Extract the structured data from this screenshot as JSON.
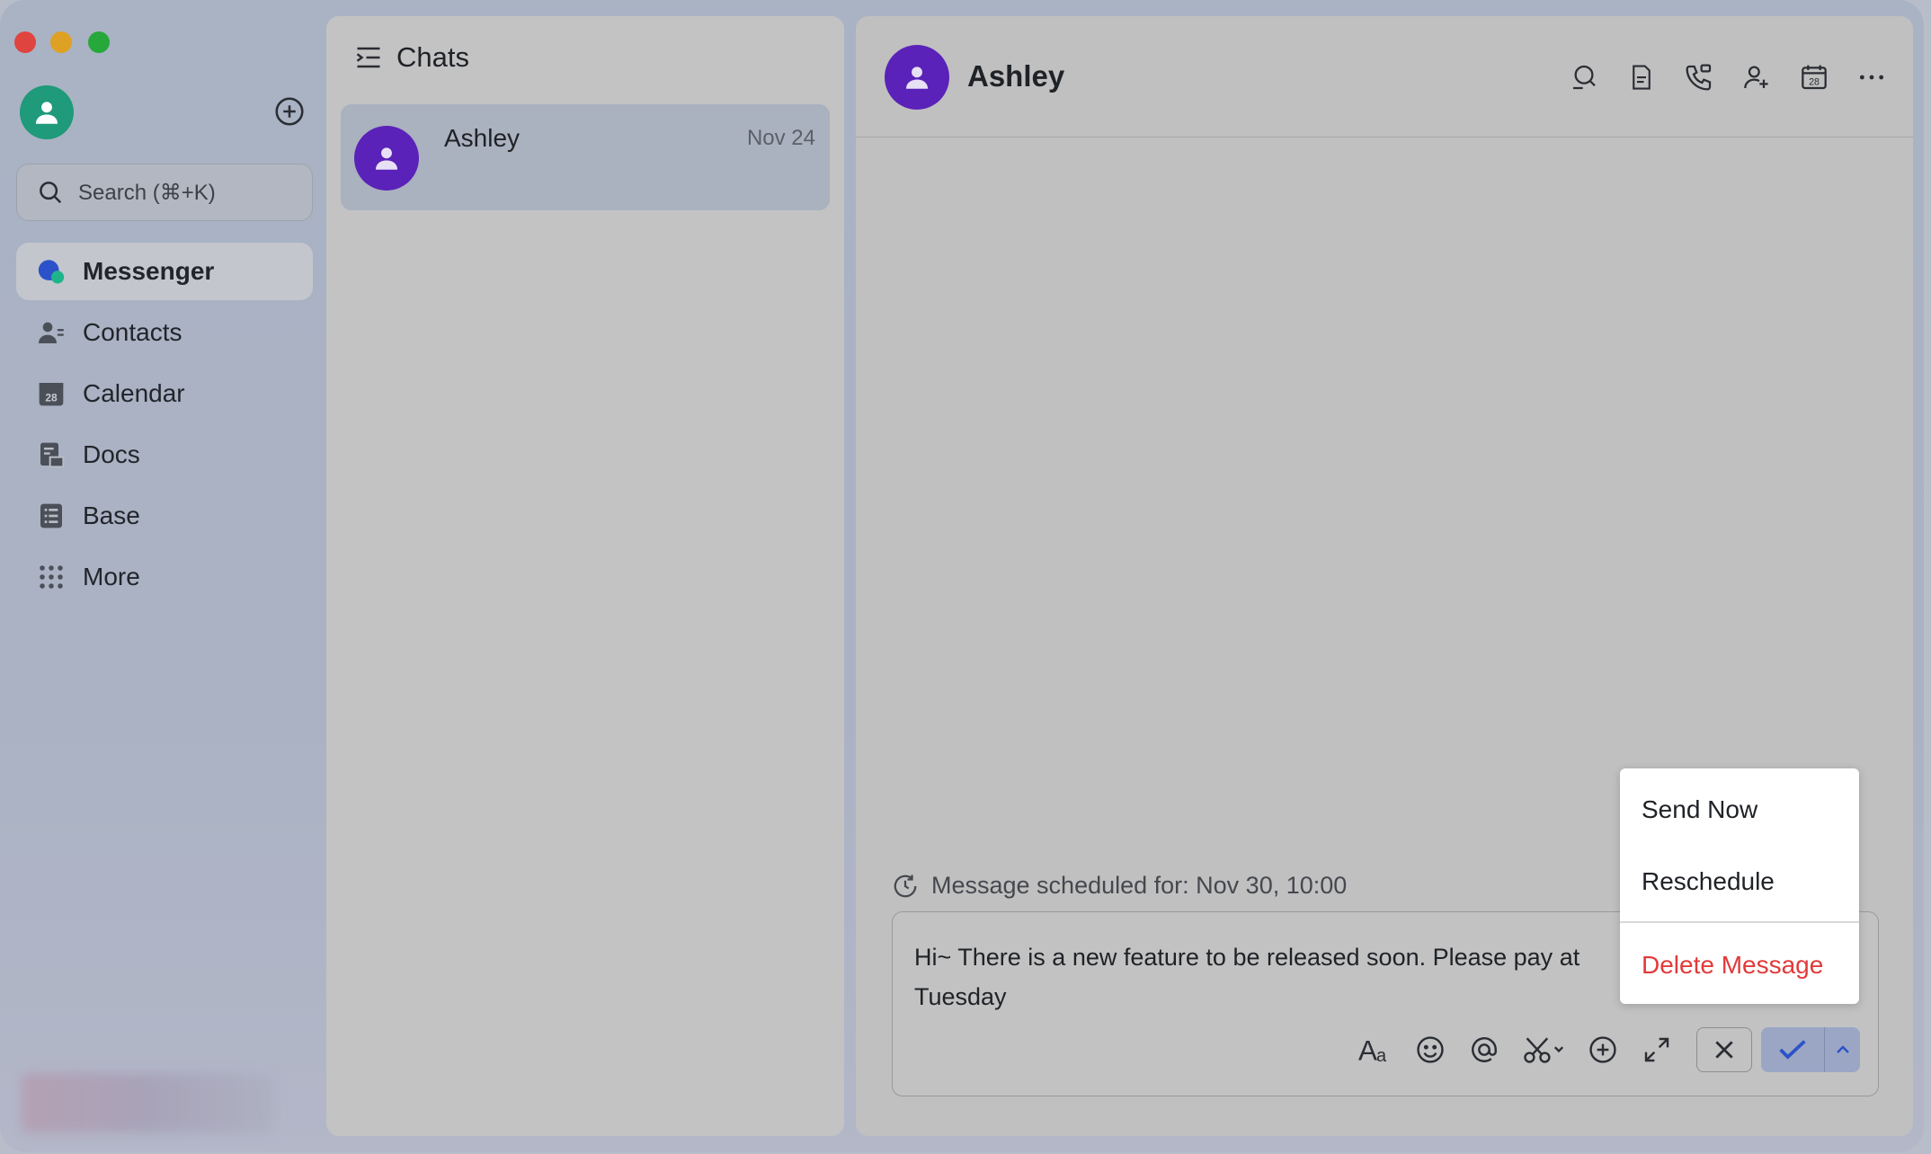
{
  "sidebar": {
    "search_placeholder": "Search (⌘+K)",
    "items": [
      {
        "label": "Messenger",
        "icon": "messenger-icon",
        "active": true
      },
      {
        "label": "Contacts",
        "icon": "contacts-icon"
      },
      {
        "label": "Calendar",
        "icon": "calendar-icon",
        "badge": "28"
      },
      {
        "label": "Docs",
        "icon": "docs-icon"
      },
      {
        "label": "Base",
        "icon": "base-icon"
      },
      {
        "label": "More",
        "icon": "grid-icon"
      }
    ]
  },
  "chat_list": {
    "title": "Chats",
    "chats": [
      {
        "name": "Ashley",
        "date": "Nov 24"
      }
    ]
  },
  "conversation": {
    "contact_name": "Ashley",
    "calendar_badge": "28",
    "scheduled_text": "Message scheduled for: Nov 30, 10:00",
    "draft_line1": "Hi~ There is a new feature to be released soon. Please pay at",
    "draft_line2": "Tuesday"
  },
  "popup_menu": {
    "send_now": "Send Now",
    "reschedule": "Reschedule",
    "delete": "Delete Message"
  },
  "colors": {
    "accent": "#2b52c9",
    "avatar_purple": "#5a22b8",
    "avatar_green": "#1f9a7a",
    "danger": "#e23a3a"
  }
}
